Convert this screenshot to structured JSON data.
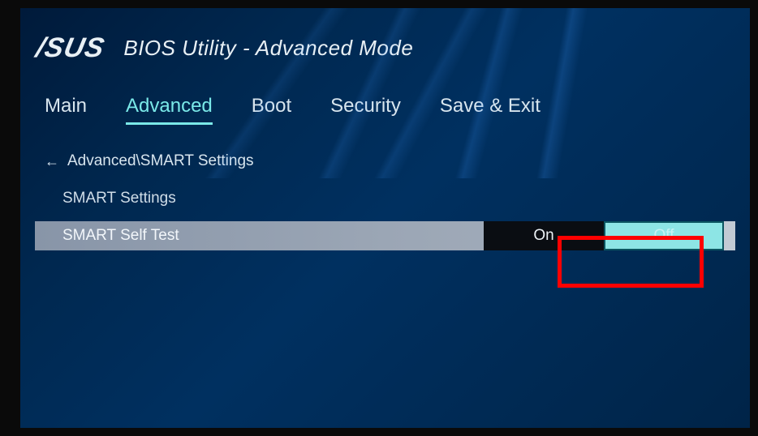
{
  "header": {
    "logo": "/SUS",
    "title": "BIOS Utility - Advanced Mode"
  },
  "tabs": [
    {
      "label": "Main",
      "active": false
    },
    {
      "label": "Advanced",
      "active": true
    },
    {
      "label": "Boot",
      "active": false
    },
    {
      "label": "Security",
      "active": false
    },
    {
      "label": "Save & Exit",
      "active": false
    }
  ],
  "breadcrumb": {
    "path": "Advanced\\SMART Settings"
  },
  "section": {
    "heading": "SMART Settings"
  },
  "setting": {
    "label": "SMART Self Test",
    "option_on": "On",
    "option_off": "Off",
    "selected": "Off"
  }
}
